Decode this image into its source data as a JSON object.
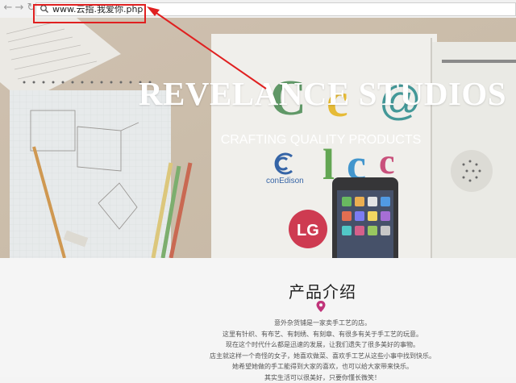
{
  "browser": {
    "url": "www.云指.我爱你.php",
    "back_icon": "back-arrow-icon",
    "forward_icon": "forward-arrow-icon",
    "refresh_icon": "refresh-icon",
    "search_icon": "search-icon"
  },
  "annotation": {
    "color": "#e02020"
  },
  "hero": {
    "title": "REVELANCE STUDIOS",
    "subtitle": "CRAFTING QUALITY PRODUCTS",
    "logos": {
      "conedison": "conEdison",
      "lg": "LG"
    }
  },
  "products": {
    "heading": "产品介绍",
    "pin_color": "#c0347a",
    "lines": [
      "意外杂货铺是一家卖手工艺的店。",
      "这里有针织、有布艺、有刺绣、有刻章、有很多有关于手工艺的玩意。",
      "现在这个时代什么都是迅速的发展，让我们遗失了很多美好的事物。",
      "店主就这样一个奇怪的女子，她喜欢做菜、喜欢手工艺从这些小事中找到快乐。",
      "她希望她做的手工能得到大家的喜欢，也可以给大家带来快乐。",
      "其实生活可以很美好，只要你懂长微笑！"
    ]
  }
}
